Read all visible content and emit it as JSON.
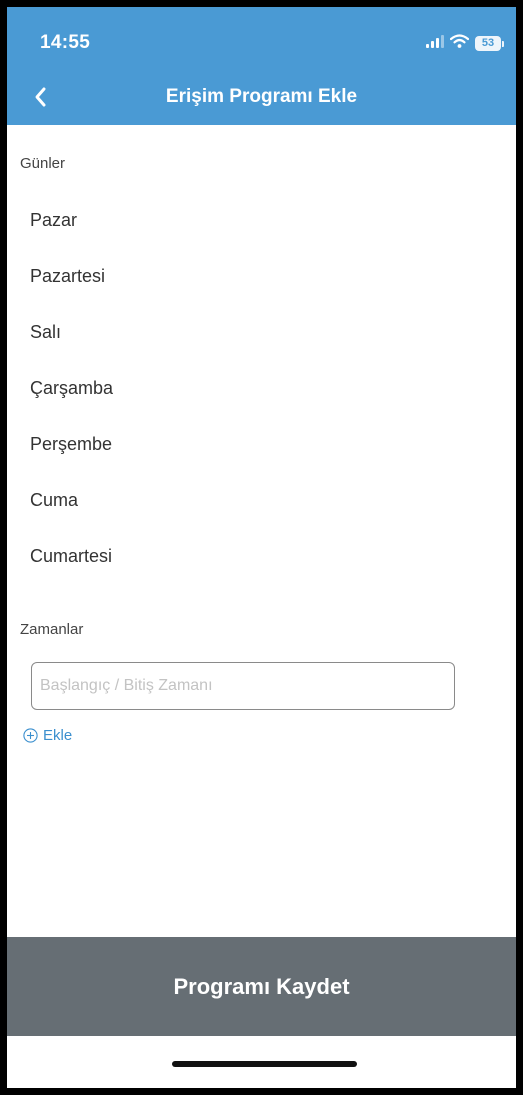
{
  "status_bar": {
    "time": "14:55",
    "battery": "53"
  },
  "header": {
    "title": "Erişim Programı Ekle"
  },
  "days_section": {
    "label": "Günler",
    "days": [
      "Pazar",
      "Pazartesi",
      "Salı",
      "Çarşamba",
      "Perşembe",
      "Cuma",
      "Cumartesi"
    ]
  },
  "times_section": {
    "label": "Zamanlar",
    "input": {
      "value": "",
      "placeholder": "Başlangıç / Bitiş Zamanı"
    },
    "add_label": "Ekle"
  },
  "footer": {
    "save_label": "Programı Kaydet"
  },
  "colors": {
    "header_bg": "#4a9ad4",
    "save_button_bg": "#666e74",
    "link_color": "#3b8fce"
  }
}
